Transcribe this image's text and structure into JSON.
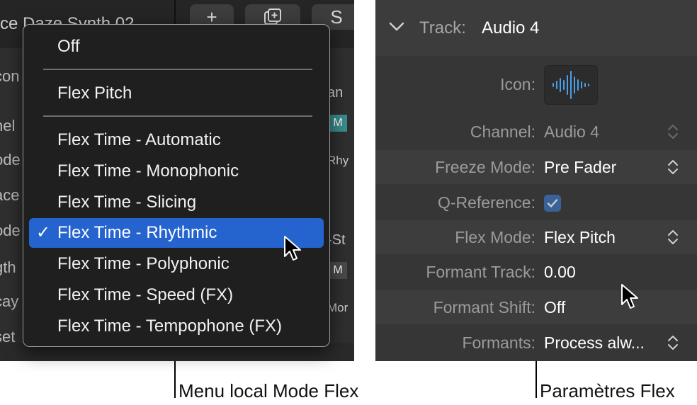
{
  "left_background": {
    "title": "ce Daze Synth 02",
    "buttons": [
      "+",
      "⧉",
      "S"
    ],
    "row_labels": [
      "con",
      "nel",
      "ode",
      "ace",
      "ode",
      "gth",
      "cay",
      "set"
    ],
    "right_cells": [
      "an",
      "Rhy",
      "-St",
      "Mor"
    ],
    "m_label": "M"
  },
  "popup_menu": {
    "items": [
      {
        "label": "Off",
        "selected": false
      },
      {
        "label": "Flex Pitch",
        "selected": false
      },
      {
        "label": "Flex Time - Automatic",
        "selected": false
      },
      {
        "label": "Flex Time - Monophonic",
        "selected": false
      },
      {
        "label": "Flex Time - Slicing",
        "selected": false
      },
      {
        "label": "Flex Time - Rhythmic",
        "selected": true
      },
      {
        "label": "Flex Time - Polyphonic",
        "selected": false
      },
      {
        "label": "Flex Time - Speed (FX)",
        "selected": false
      },
      {
        "label": "Flex Time - Tempophone (FX)",
        "selected": false
      }
    ],
    "checkmark": "✓",
    "selection_color": "#2563cf"
  },
  "inspector": {
    "header_label": "Track:",
    "header_value": "Audio 4",
    "icon_label": "Icon:",
    "icon_name": "waveform-icon",
    "rows": [
      {
        "label": "Channel:",
        "value": "Audio 4"
      },
      {
        "label": "Freeze Mode:",
        "value": "Pre Fader"
      },
      {
        "label": "Q-Reference:",
        "value": ""
      },
      {
        "label": "Flex Mode:",
        "value": "Flex Pitch"
      },
      {
        "label": "Formant Track:",
        "value": "0.00"
      },
      {
        "label": "Formant Shift:",
        "value": "Off"
      },
      {
        "label": "Formants:",
        "value": "Process alw..."
      }
    ],
    "q_reference_checked": true,
    "accent_color": "#3a6aa8"
  },
  "captions": {
    "left": "Menu local Mode Flex",
    "right": "Paramètres Flex"
  }
}
